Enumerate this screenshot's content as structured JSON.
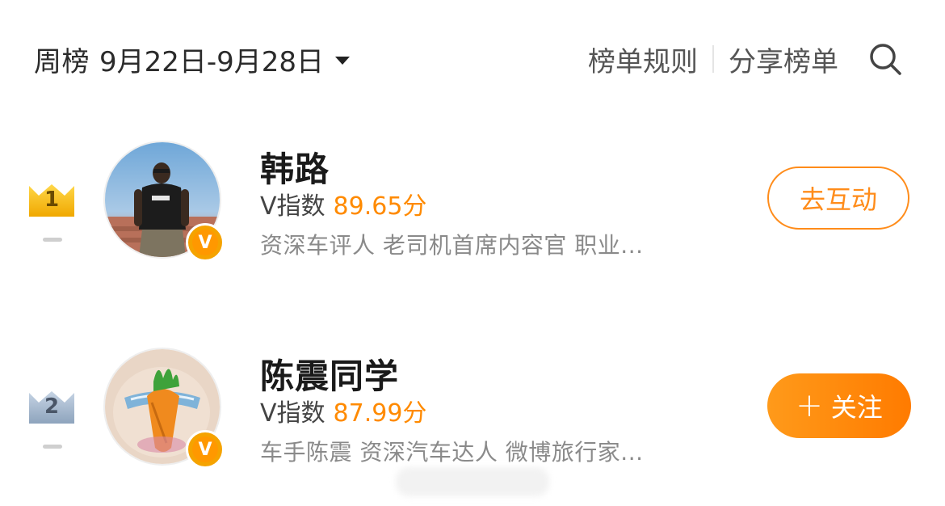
{
  "header": {
    "week_label": "周榜",
    "week_range": "9月22日-9月28日",
    "rules_link": "榜单规则",
    "share_link": "分享榜单"
  },
  "ranking": [
    {
      "rank": "1",
      "name": "韩路",
      "vindex_label": "V指数",
      "vindex_score": "89.65分",
      "description": "资深车评人 老司机首席内容官 职业...",
      "action_label": "去互动"
    },
    {
      "rank": "2",
      "name": "陈震同学",
      "vindex_label": "V指数",
      "vindex_score": "87.99分",
      "description": "车手陈震 资深汽车达人 微博旅行家...",
      "action_label": "关注",
      "action_prefix": "+"
    }
  ],
  "badge_letter": "V",
  "colors": {
    "accent": "#ff8c1a",
    "gold_crown": "#f5b400",
    "silver_crown": "#8fa6bf",
    "verified": "#f5a300"
  },
  "icons": [
    "caret-down-icon",
    "search-icon",
    "crown-gold-icon",
    "crown-silver-icon",
    "verified-v-icon"
  ]
}
